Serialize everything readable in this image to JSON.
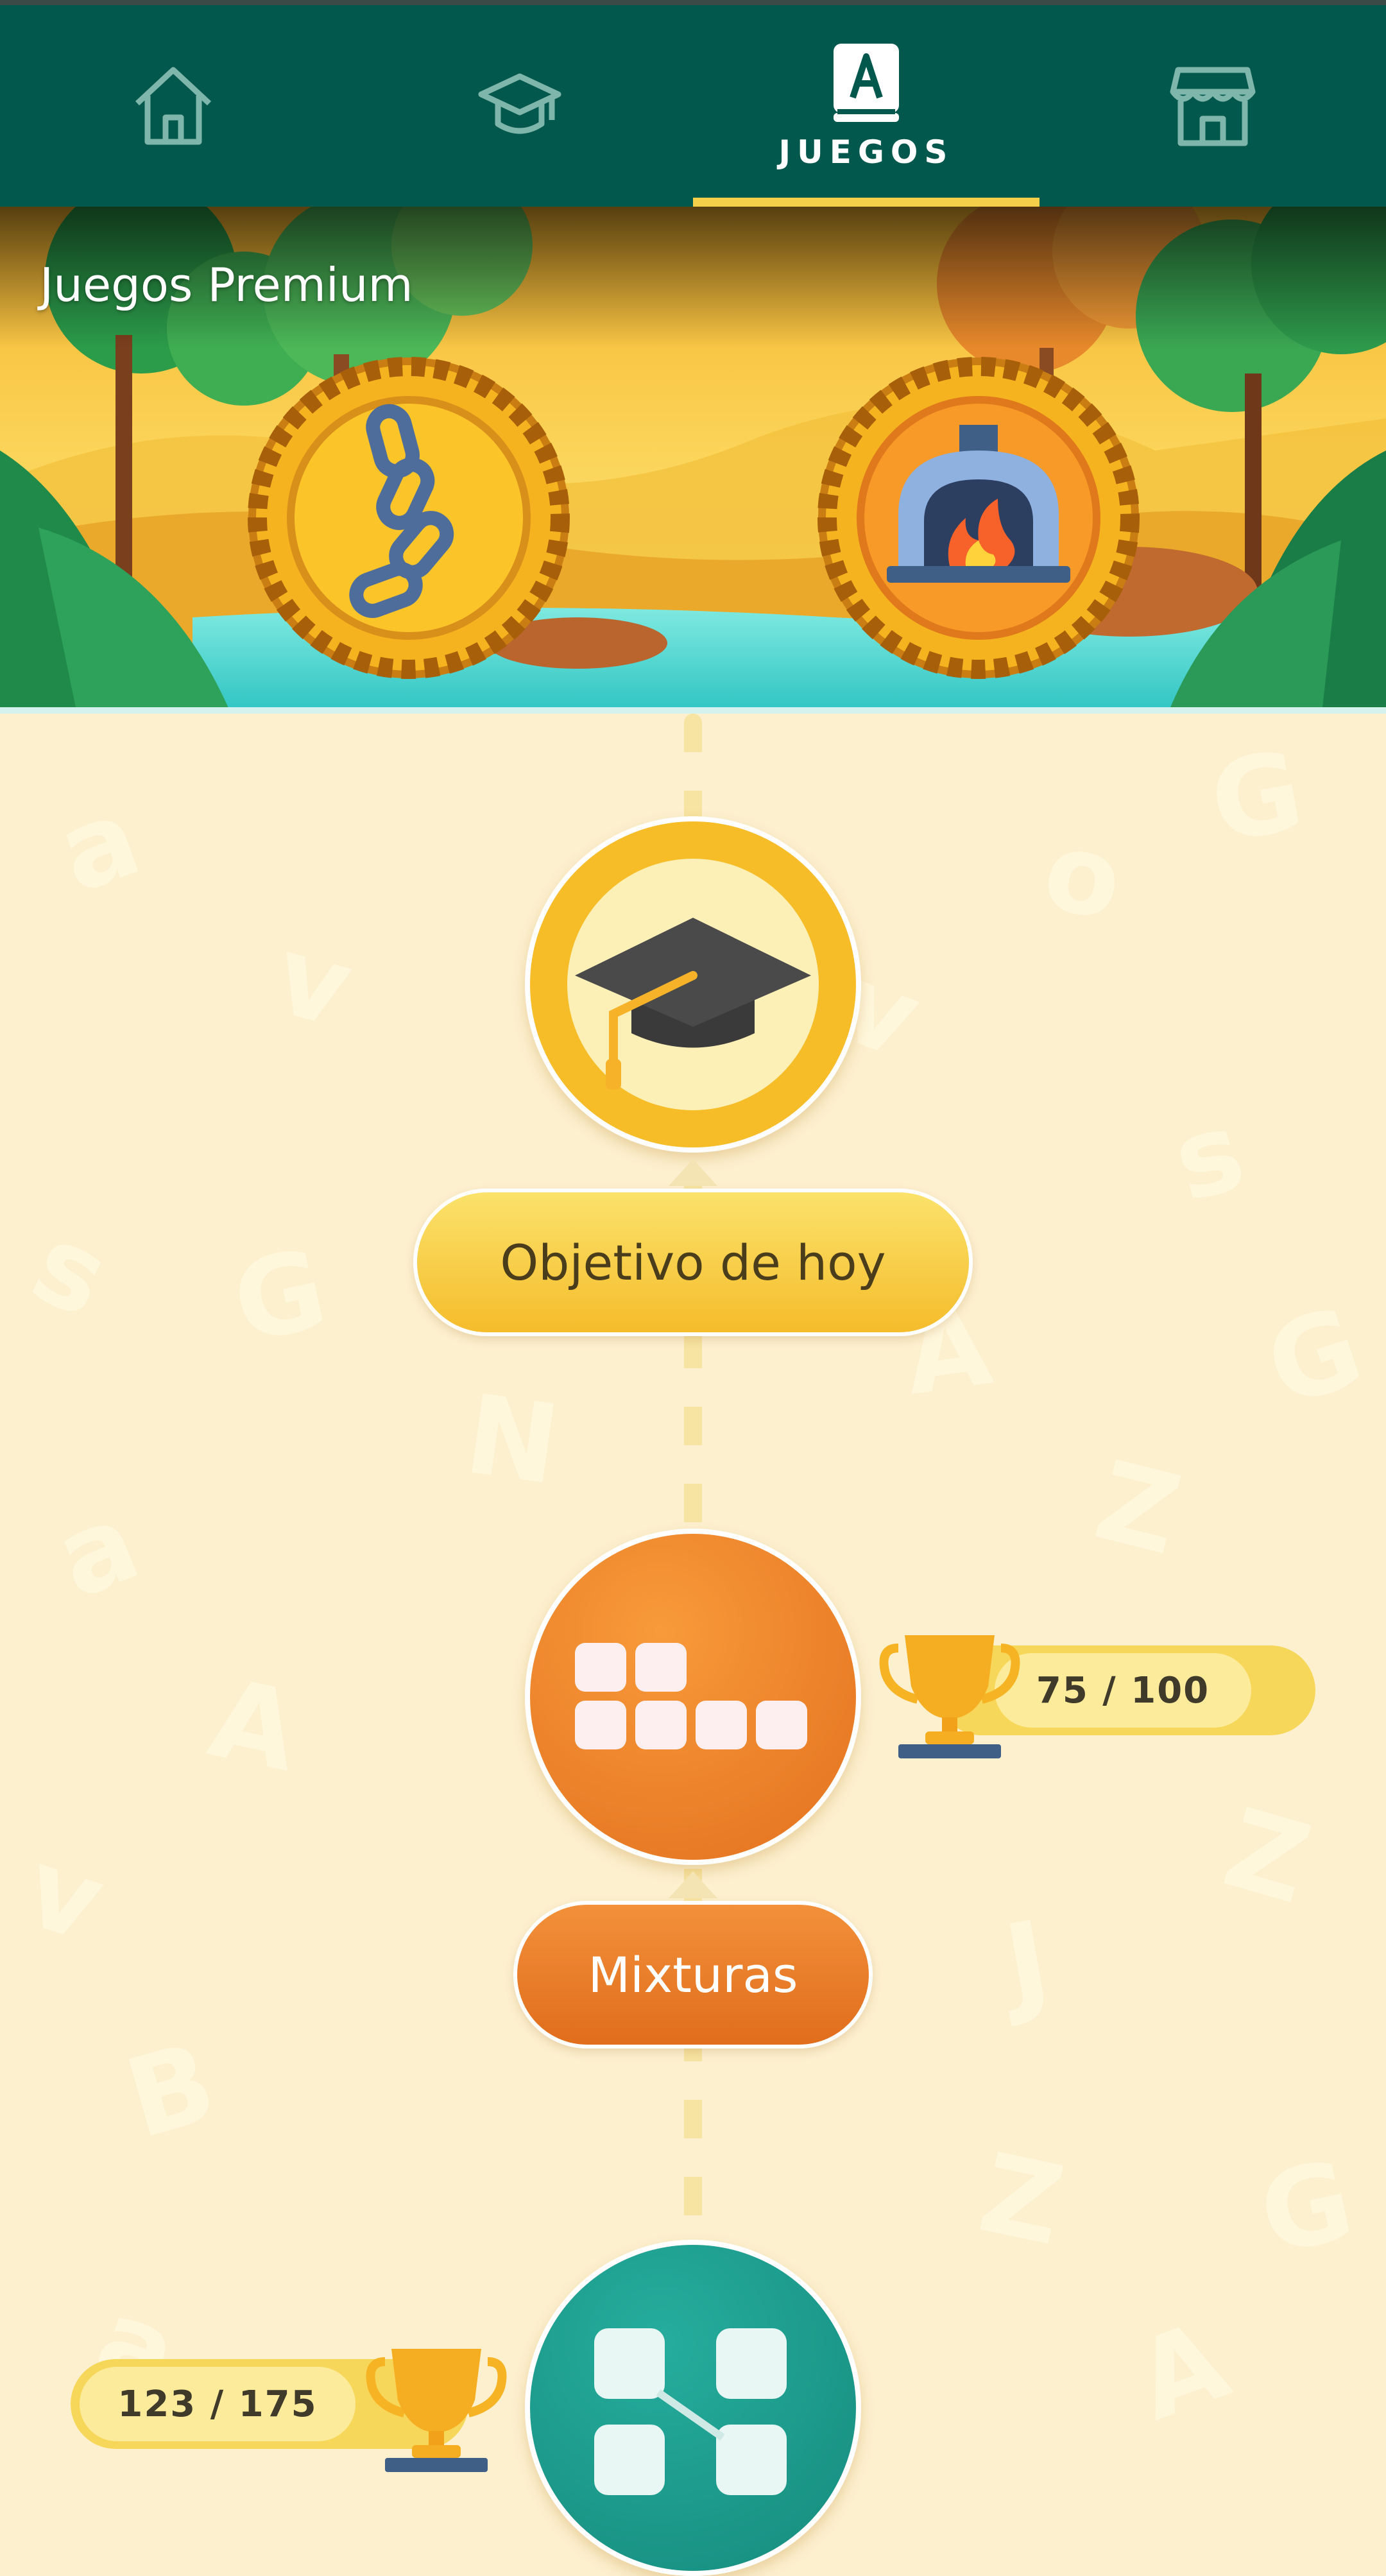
{
  "nav": {
    "tabs": [
      {
        "name": "home",
        "icon": "home-icon",
        "label": ""
      },
      {
        "name": "learn",
        "icon": "graduation-cap-icon",
        "label": ""
      },
      {
        "name": "games",
        "icon": "dictionary-book-icon",
        "label": "JUEGOS",
        "active": true
      },
      {
        "name": "store",
        "icon": "store-icon",
        "label": ""
      }
    ]
  },
  "banner": {
    "title": "Juegos Premium",
    "medals": [
      {
        "icon": "chain-icon"
      },
      {
        "icon": "oven-fire-icon"
      }
    ]
  },
  "path": {
    "nodes": [
      {
        "label": "Objetivo de hoy",
        "icon": "graduation-cap-icon"
      },
      {
        "label": "Mixturas",
        "icon": "letter-tiles-icon",
        "score": "75 / 100",
        "progress": 0.75
      },
      {
        "label": "",
        "icon": "connected-tiles-icon",
        "score": "123 / 175",
        "progress": 0.7
      }
    ]
  },
  "colors": {
    "nav_bg": "#03584d",
    "active_indicator": "#f3cf4a",
    "page_bg": "#fdf0cf",
    "gold": "#f6c02f",
    "orange": "#e9792a",
    "teal": "#1c9a8c"
  }
}
